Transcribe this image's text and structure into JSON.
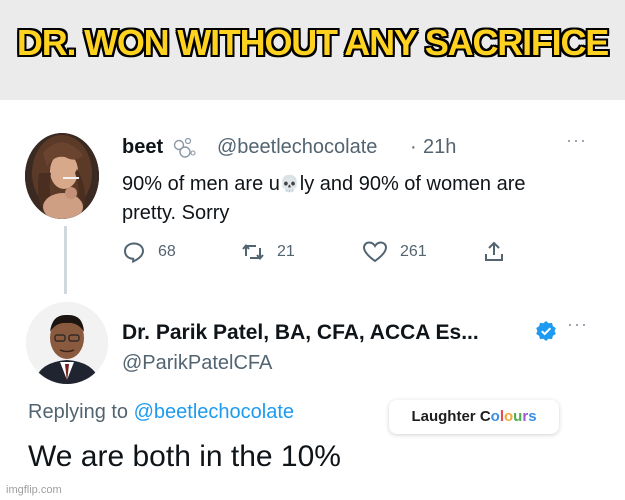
{
  "banner": {
    "title": "DR. WON WITHOUT ANY SACRIFICE"
  },
  "tweet1": {
    "name": "beet",
    "name_icon": "bubbles-icon",
    "handle": "@beetlechocolate",
    "dot": "·",
    "time": "21h",
    "text_before": "90% of men are u",
    "text_emoji": "💀",
    "text_after": "ly and 90% of women are pretty. Sorry",
    "replies": "68",
    "retweets": "21",
    "likes": "261"
  },
  "tweet2": {
    "name": "Dr. Parik Patel, BA, CFA, ACCA Es...",
    "verified_icon": "verified-badge-icon",
    "handle": "@ParikPatelCFA",
    "replying_prefix": "Replying to ",
    "replying_handle": "@beetlechocolate",
    "text": "We are both in the 10%"
  },
  "watermarks": {
    "laughter_a": "Laughter ",
    "laughter_o1": "C",
    "laughter_o2": "o",
    "laughter_l": "l",
    "laughter_o3": "o",
    "laughter_u": "u",
    "laughter_r": "r",
    "laughter_s": "s",
    "imgflip": "imgflip.com"
  },
  "colors": {
    "banner_text": "#ffd21f",
    "link_blue": "#1d9bf0",
    "muted_text": "#536471"
  },
  "more": "···"
}
